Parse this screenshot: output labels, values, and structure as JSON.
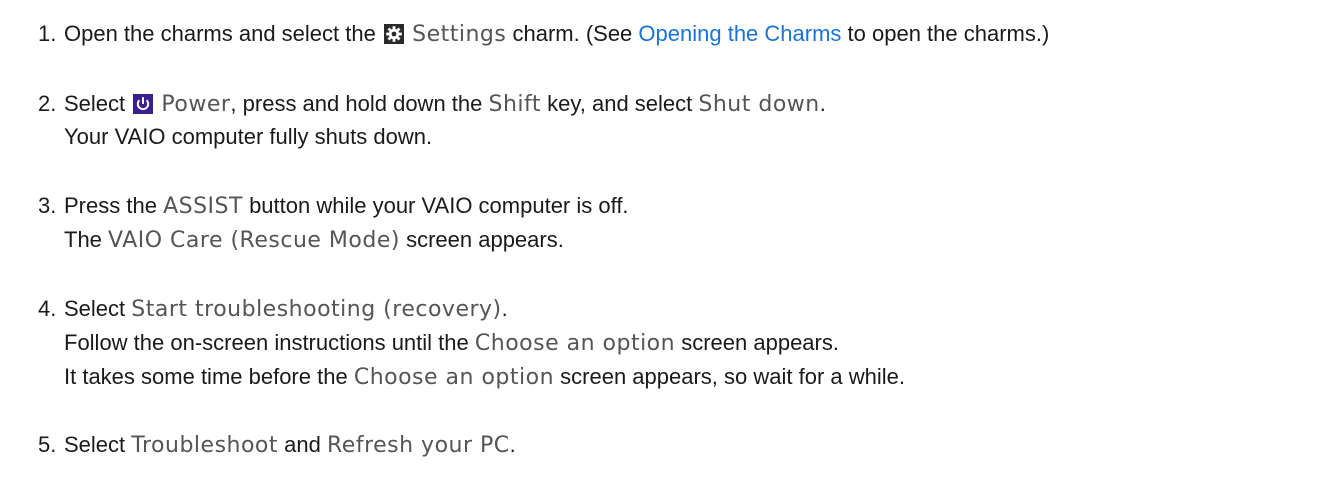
{
  "steps": [
    {
      "number": "1.",
      "lines": [
        {
          "pre": "Open the charms and select the",
          "icon": "settings-gear-icon",
          "ui": "Settings",
          "mid": "charm. (See",
          "link": "Opening the Charms",
          "post": "to open the charms.)"
        }
      ]
    },
    {
      "number": "2.",
      "lines": [
        {
          "pre": "Select",
          "icon": "power-icon",
          "ui1": "Power",
          "mid": ", press and hold down the",
          "ui2": "Shift",
          "mid2": "key, and select",
          "ui3": "Shut down",
          "post": "."
        },
        {
          "text": "Your VAIO computer fully shuts down."
        }
      ]
    },
    {
      "number": "3.",
      "lines": [
        {
          "pre": "Press the",
          "ui": "ASSIST",
          "post": "button while your VAIO computer is off."
        },
        {
          "pre": "The",
          "ui": "VAIO Care (Rescue Mode)",
          "post": "screen appears."
        }
      ]
    },
    {
      "number": "4.",
      "lines": [
        {
          "pre": "Select",
          "ui": "Start troubleshooting (recovery)",
          "post": "."
        },
        {
          "pre": "Follow the on-screen instructions until the",
          "ui": "Choose an option",
          "post": "screen appears."
        },
        {
          "pre": "It takes some time before the",
          "ui": "Choose an option",
          "post": "screen appears, so wait for a while."
        }
      ]
    },
    {
      "number": "5.",
      "lines": [
        {
          "pre": "Select",
          "ui1": "Troubleshoot",
          "mid": "and",
          "ui2": "Refresh your PC",
          "post": "."
        }
      ]
    }
  ],
  "colors": {
    "link": "#1a73d6",
    "ui_text": "#555555",
    "power_icon_bg": "#3b1f8f",
    "settings_icon_bg": "#2a2a2a"
  }
}
